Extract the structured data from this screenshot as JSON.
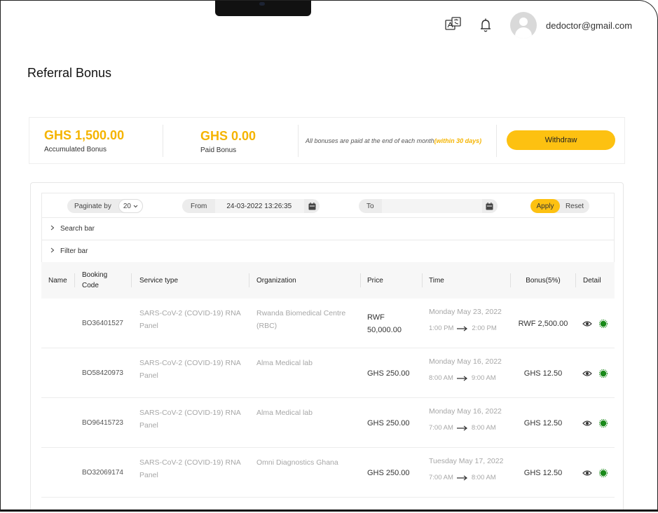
{
  "header": {
    "email": "dedoctor@gmail.com",
    "icons": [
      "translate-icon",
      "bell-icon",
      "avatar"
    ]
  },
  "page": {
    "title": "Referral Bonus"
  },
  "summary": {
    "accumulated_amount": "GHS 1,500.00",
    "accumulated_label": "Accumulated Bonus",
    "paid_amount": "GHS 0.00",
    "paid_label": "Paid Bonus",
    "note": "All bonuses are paid at the end of each month",
    "note_highlight": "(within 30 days)",
    "withdraw_label": "Withdraw"
  },
  "filters": {
    "paginate_label": "Paginate by",
    "paginate_value": "20",
    "from_label": "From",
    "from_value": "24-03-2022  13:26:35",
    "to_label": "To",
    "to_value": "",
    "apply_label": "Apply",
    "reset_label": "Reset",
    "search_bar_label": "Search bar",
    "filter_bar_label": "Filter bar"
  },
  "table": {
    "columns": {
      "name": "Name",
      "booking_code_1": "Booking",
      "booking_code_2": "Code",
      "service_type": "Service type",
      "organization": "Organization",
      "price": "Price",
      "time": "Time",
      "bonus": "Bonus(5%)",
      "detail": "Detail"
    },
    "rows": [
      {
        "code": "BO36401527",
        "service_1": "SARS-CoV-2 (COVID-19) RNA",
        "service_2": "Panel",
        "org_1": "Rwanda Biomedical Centre",
        "org_2": "(RBC)",
        "price_1": "RWF",
        "price_2": "50,000.00",
        "date": "Monday May 23, 2022",
        "start": "1:00 PM",
        "end": "2:00 PM",
        "bonus": "RWF 2,500.00"
      },
      {
        "code": "BO58420973",
        "service_1": "SARS-CoV-2 (COVID-19) RNA",
        "service_2": "Panel",
        "org_1": "Alma Medical lab",
        "org_2": "",
        "price_1": "GHS 250.00",
        "price_2": "",
        "date": "Monday May 16, 2022",
        "start": "8:00 AM",
        "end": "9:00 AM",
        "bonus": "GHS 12.50"
      },
      {
        "code": "BO96415723",
        "service_1": "SARS-CoV-2 (COVID-19) RNA",
        "service_2": "Panel",
        "org_1": "Alma Medical lab",
        "org_2": "",
        "price_1": "GHS 250.00",
        "price_2": "",
        "date": "Monday May 16, 2022",
        "start": "7:00 AM",
        "end": "8:00 AM",
        "bonus": "GHS 12.50"
      },
      {
        "code": "BO32069174",
        "service_1": "SARS-CoV-2 (COVID-19) RNA",
        "service_2": "Panel",
        "org_1": "Omni Diagnostics Ghana",
        "org_2": "",
        "price_1": "GHS 250.00",
        "price_2": "",
        "date": "Tuesday May 17, 2022",
        "start": "7:00 AM",
        "end": "8:00 AM",
        "bonus": "GHS 12.50"
      }
    ]
  },
  "colors": {
    "accent": "#fdc111",
    "amount": "#f5b400",
    "status_dot": "#1a8a1a"
  }
}
